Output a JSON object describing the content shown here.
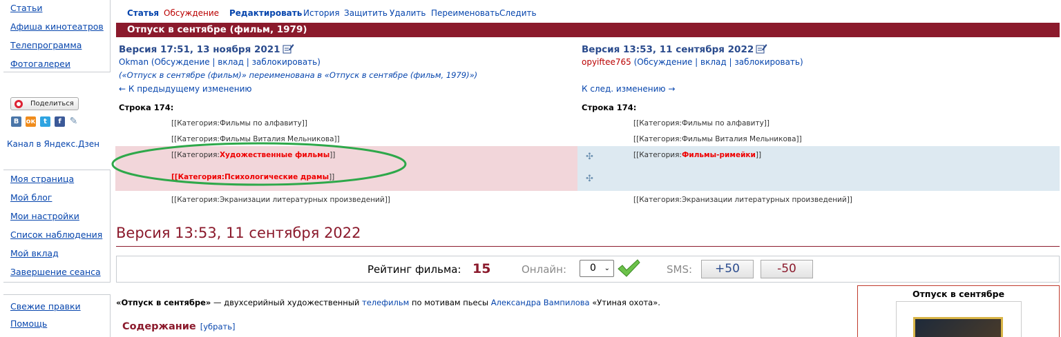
{
  "sidebar": {
    "top_links": [
      "Статьи",
      "Афиша кинотеатров",
      "Телепрограмма",
      "Фотогалереи"
    ],
    "share_button": "Поделиться",
    "social_icons": [
      {
        "name": "vk-icon",
        "label": "В",
        "color": "#4a76a8"
      },
      {
        "name": "ok-icon",
        "label": "ок",
        "color": "#f08c1c"
      },
      {
        "name": "twitter-icon",
        "label": "t",
        "color": "#2fa4e1"
      },
      {
        "name": "facebook-icon",
        "label": "f",
        "color": "#3b5998"
      },
      {
        "name": "link-icon",
        "label": "✎",
        "color": "#6d8fb0"
      }
    ],
    "yandex_channel": "Канал в Яндекс.Дзен",
    "personal_links": [
      "Моя страница",
      "Мой блог",
      "Мои настройки",
      "Список наблюдения",
      "Мой вклад",
      "Завершение сеанса"
    ],
    "bottom_links": [
      "Свежие правки",
      "Помощь"
    ]
  },
  "tabs": [
    "Статья",
    "Обсуждение",
    "Редактировать",
    "История",
    "Защитить",
    "Удалить",
    "Переименовать",
    "Следить"
  ],
  "page_title": "Отпуск в сентябре (фильм, 1979)",
  "diff": {
    "left": {
      "version": "Версия 17:51, 13 ноября 2021",
      "user": "Okman",
      "user_links": "(Обсуждение | вклад | заблокировать)",
      "summary": "(«Отпуск в сентябре (фильм)» переименована в «Отпуск в сентябре (фильм, 1979)»)",
      "nav": "← К предыдущему изменению",
      "line_label": "Строка 174:"
    },
    "right": {
      "version": "Версия 13:53, 11 сентября 2022",
      "user": "opyiftee765",
      "user_links": "(Обсуждение | вклад | заблокировать)",
      "nav": "К след. изменению →",
      "line_label": "Строка 174:"
    },
    "context_lines": [
      "[[Категория:Фильмы по алфавиту]]",
      "[[Категория:Фильмы Виталия Мельникова]]",
      "[[Категория:Экранизации литературных произведений]]"
    ],
    "deleted": {
      "line1_prefix": "[[Категория:",
      "line1_changed": "Художественные фильмы",
      "line1_suffix": "]]",
      "line2_changed": "[[Категория:Психологические драмы",
      "line2_suffix": "]]"
    },
    "added": {
      "line1_prefix": "[[Категория:",
      "line1_changed": "Фильмы-римейки",
      "line1_suffix": "]]"
    }
  },
  "version_heading": "Версия 13:53, 11 сентября 2022",
  "rating": {
    "label": "Рейтинг фильма:",
    "value": "15",
    "online_label": "Онлайн:",
    "select_value": "0",
    "sms_label": "SMS:",
    "plus_button": "+50",
    "minus_button": "-50"
  },
  "article": {
    "intro_bold": "Отпуск в сентябре",
    "intro_1": " — двухсерийный художественный ",
    "intro_link1": "телефильм",
    "intro_2": " по мотивам пьесы ",
    "intro_link2": "Александра Вампилова",
    "intro_3": " «Утиная охота».",
    "toc_title": "Содержание",
    "toc_hide": "[убрать]",
    "infobox_title": "Отпуск в сентябре"
  },
  "colors": {
    "brand": "#8b1a2c",
    "link": "#0645ad",
    "deleted_bg": "#f2d6da",
    "added_bg": "#dde9f1",
    "highlight": "#e00000",
    "annotation_oval": "#2ea84a"
  }
}
